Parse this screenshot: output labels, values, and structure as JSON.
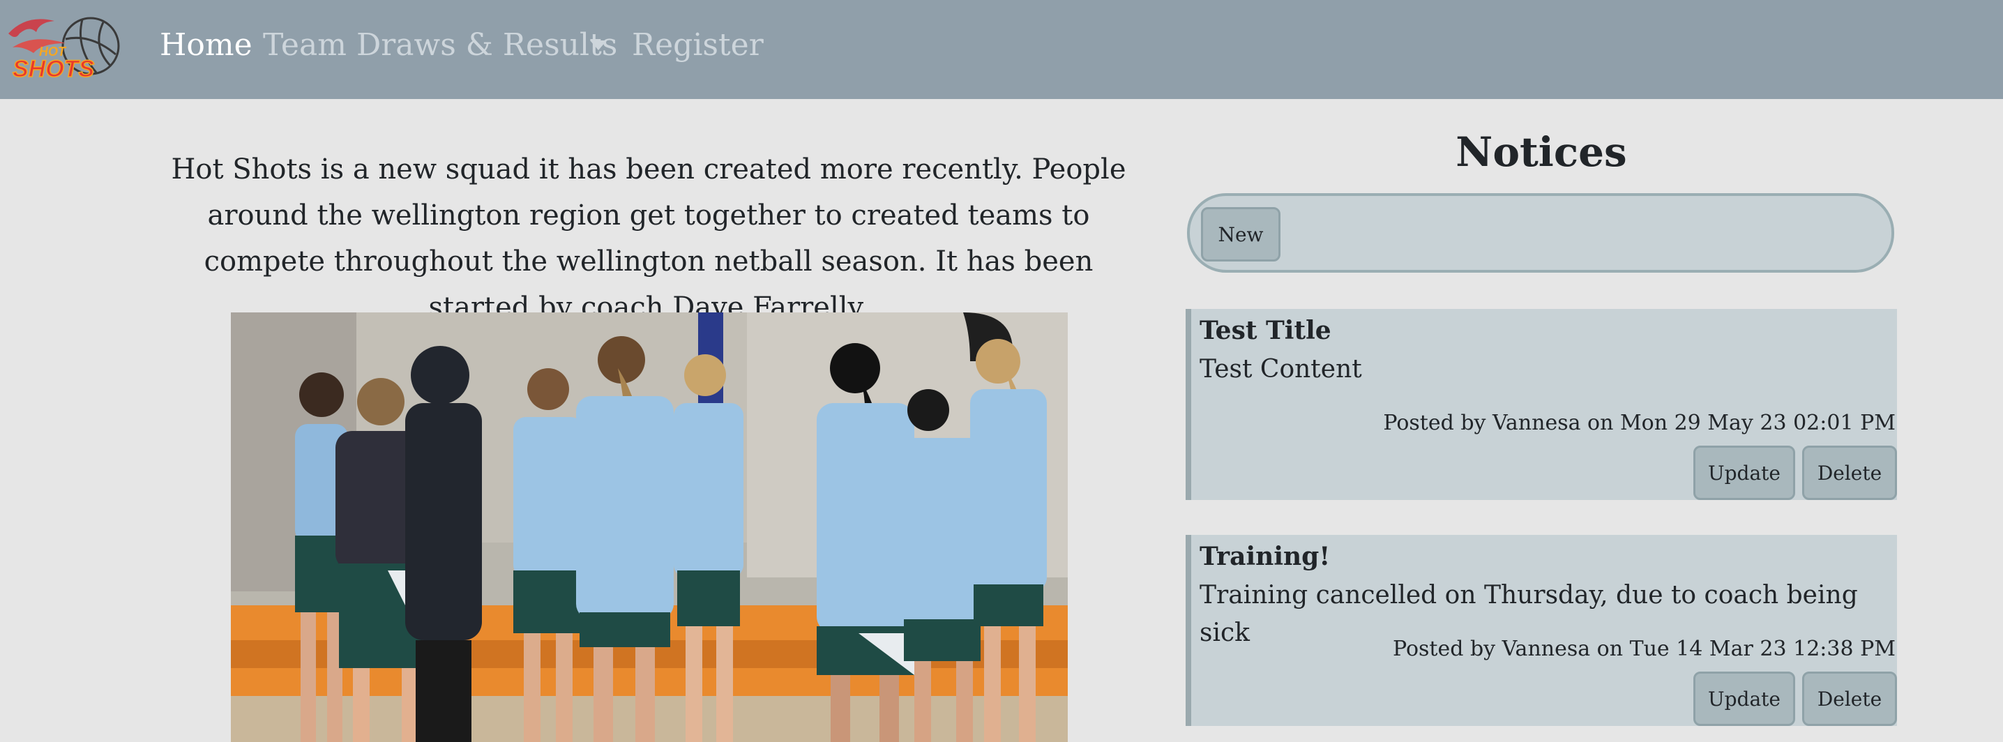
{
  "nav": {
    "logo_text": "HOT SHOTS",
    "links": [
      "Home",
      "Team",
      "Draws & Results",
      "Register"
    ]
  },
  "intro": {
    "text": "Hot Shots is a new squad it has been created more recently. People around the wellington region get together to created teams to compete throughout the wellington netball season. It has been started by coach Dave Farrelly."
  },
  "notices": {
    "heading": "Notices",
    "new_label": "New",
    "items": [
      {
        "title": "Test Title",
        "content": "Test Content",
        "meta": "Posted by Vannesa on Mon 29 May 23 02:01 PM",
        "update_label": "Update",
        "delete_label": "Delete"
      },
      {
        "title": "Training!",
        "content": "Training cancelled on Thursday, due to coach being sick",
        "meta": "Posted by Vannesa on Tue 14 Mar 23 12:38 PM",
        "update_label": "Update",
        "delete_label": "Delete"
      }
    ]
  },
  "colors": {
    "navbar": "#909faa",
    "background": "#e6e6e6",
    "notice_bg": "#c8d2d6",
    "button_bg": "#a9b8bd",
    "logo_red": "#e8392b",
    "logo_orange": "#f5a623"
  }
}
